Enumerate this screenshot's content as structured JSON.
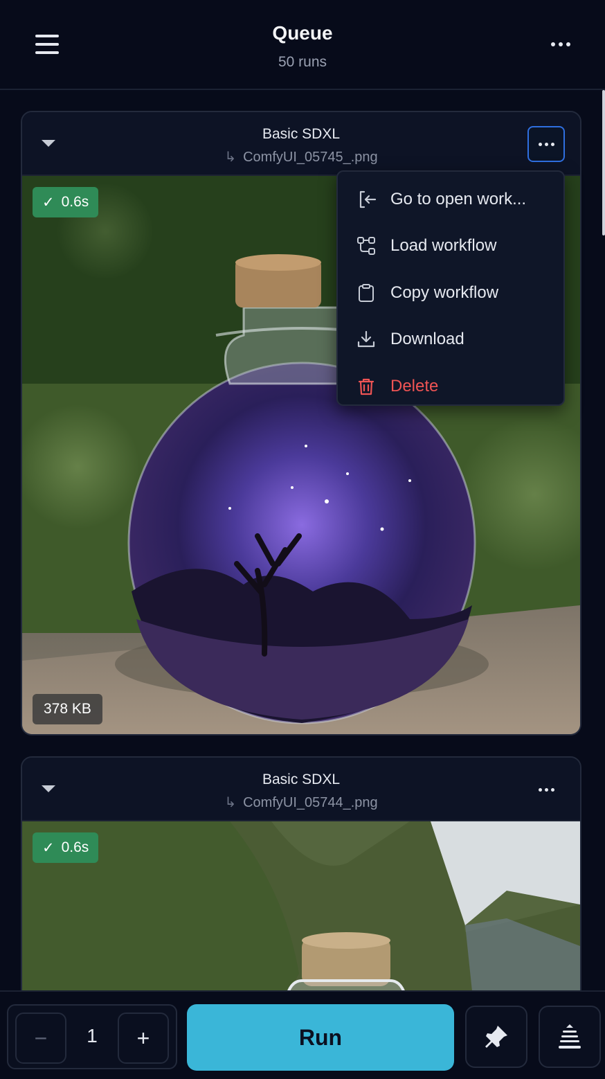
{
  "header": {
    "title": "Queue",
    "subtitle": "50 runs"
  },
  "runs": [
    {
      "workflow": "Basic SDXL",
      "file": "ComfyUI_05745_.png",
      "duration": "0.6s",
      "size": "378 KB",
      "image": "glass-bottle-with-galaxy-and-tree"
    },
    {
      "workflow": "Basic SDXL",
      "file": "ComfyUI_05744_.png",
      "duration": "0.6s",
      "image": "glass-jar-with-cork-on-mountain-cliff"
    }
  ],
  "menu": {
    "items": [
      {
        "label": "Go to open work...",
        "icon": "go-to-open-icon"
      },
      {
        "label": "Load workflow",
        "icon": "load-workflow-icon"
      },
      {
        "label": "Copy workflow",
        "icon": "clipboard-icon"
      },
      {
        "label": "Download",
        "icon": "download-icon"
      },
      {
        "label": "Delete",
        "icon": "trash-icon"
      }
    ]
  },
  "toolbar": {
    "count": "1",
    "minus_label": "−",
    "plus_label": "+",
    "run_label": "Run"
  },
  "colors": {
    "background": "#070b1a",
    "accent": "#3ab6d8",
    "success": "#2f8b57",
    "danger": "#ef5454"
  }
}
